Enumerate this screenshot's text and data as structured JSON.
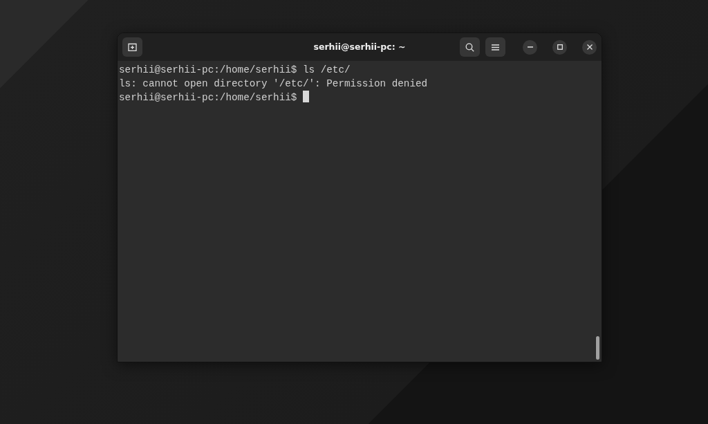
{
  "window": {
    "title": "serhii@serhii-pc: ~"
  },
  "terminal": {
    "lines": [
      {
        "text": "serhii@serhii-pc:/home/serhii$ ls /etc/",
        "cursor": false
      },
      {
        "text": "ls: cannot open directory '/etc/': Permission denied",
        "cursor": false
      },
      {
        "text": "serhii@serhii-pc:/home/serhii$ ",
        "cursor": true
      }
    ]
  }
}
